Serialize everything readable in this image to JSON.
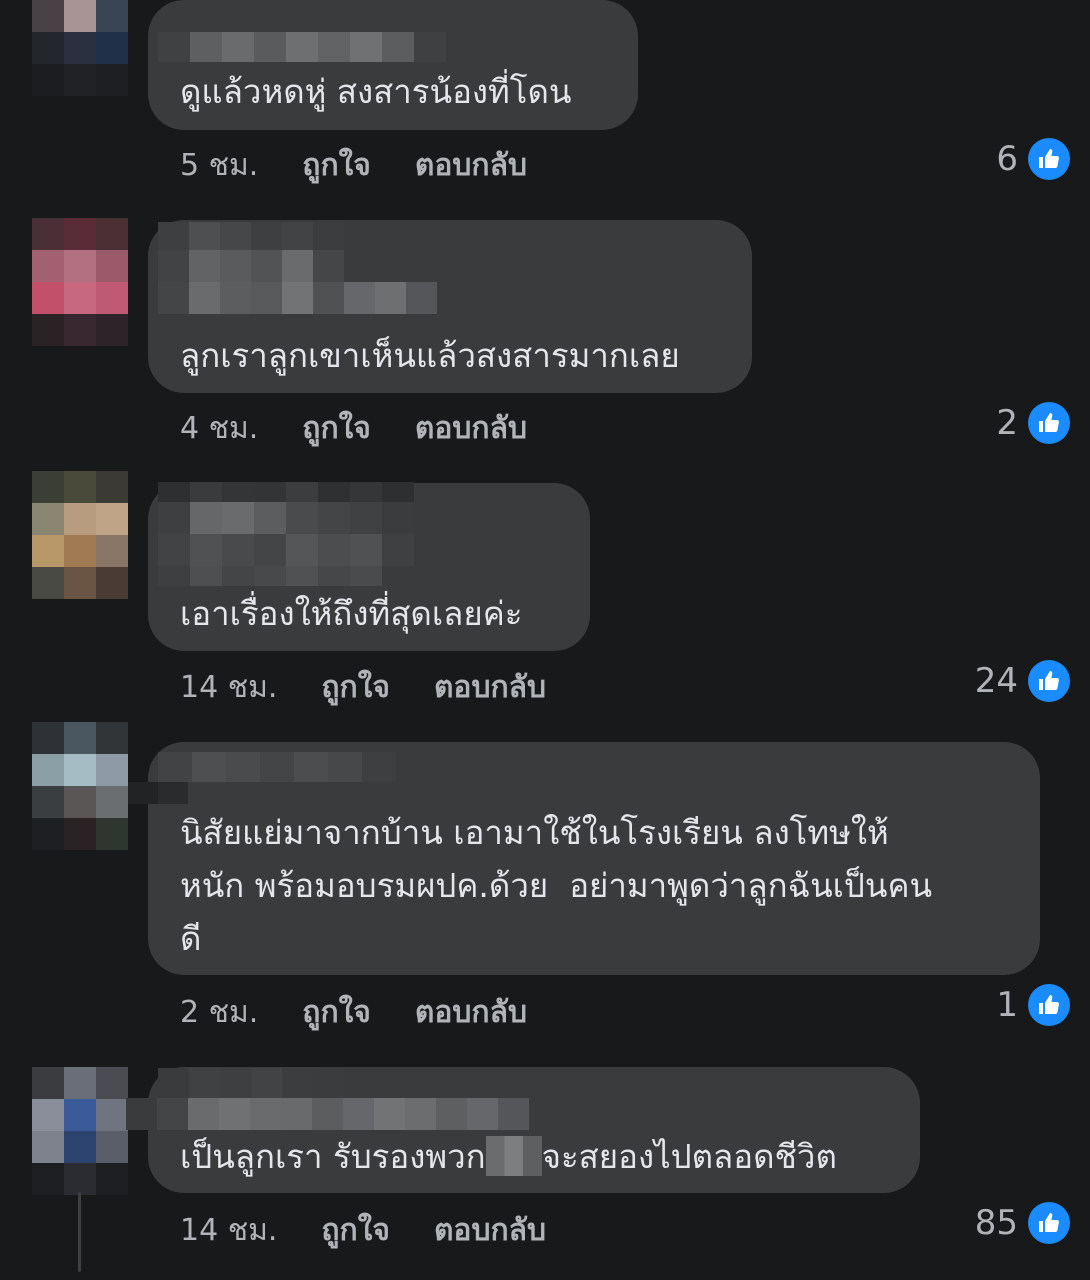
{
  "colors": {
    "background": "#18191a",
    "bubble": "#3a3b3c",
    "text": "#e4e6eb",
    "meta_text": "#b0b3b8",
    "like_blue": "#1a8cff"
  },
  "icons": {
    "like": "thumbs-up-icon"
  },
  "comments": [
    {
      "text": "ดูแล้วหดหู่ สงสารน้องที่โดน",
      "time": "5 ชม.",
      "like_label": "ถูกใจ",
      "reply_label": "ตอบกลับ",
      "reaction_count": "6"
    },
    {
      "text": "ลูกเราลูกเขาเห็นแล้วสงสารมากเลย",
      "time": "4 ชม.",
      "like_label": "ถูกใจ",
      "reply_label": "ตอบกลับ",
      "reaction_count": "2"
    },
    {
      "text": "เอาเรื่องให้ถึงที่สุดเลยค่ะ",
      "time": "14 ชม.",
      "like_label": "ถูกใจ",
      "reply_label": "ตอบกลับ",
      "reaction_count": "24"
    },
    {
      "text": "นิสัยแย่มาจากบ้าน เอามาใช้ในโรงเรียน ลงโทษให้\nหนัก พร้อมอบรมผปค.ด้วย  อย่ามาพูดว่าลูกฉันเป็นคน\nดี",
      "time": "2 ชม.",
      "like_label": "ถูกใจ",
      "reply_label": "ตอบกลับ",
      "reaction_count": "1"
    },
    {
      "text_before": "เป็นลูกเรา รับรองพวก",
      "text_after": "จะสยองไปตลอดชีวิต",
      "time": "14 ชม.",
      "like_label": "ถูกใจ",
      "reply_label": "ตอบกลับ",
      "reaction_count": "85"
    }
  ]
}
